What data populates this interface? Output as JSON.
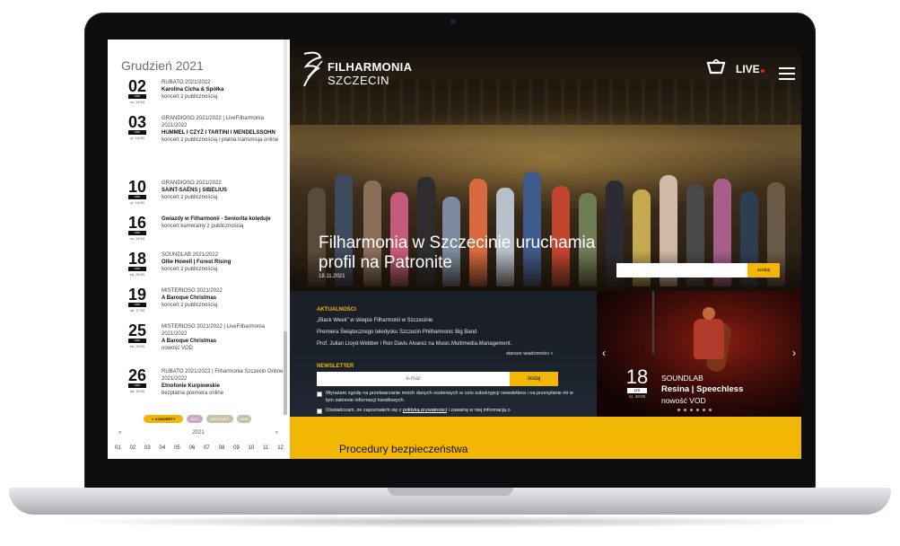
{
  "calendar": {
    "month": "Grudzień 2021",
    "events": [
      {
        "day": "02",
        "dow": "cz, 19:00",
        "cycle": "RUBATO 2021/2022",
        "title": "Karolina Cicha & Spółka",
        "desc": "koncert z publicznością"
      },
      {
        "day": "03",
        "dow": "pt, 19:00",
        "cycle": "GRANDIOSO 2021/2022 | LiveFilharmonia 2021/2022",
        "title": "HUMMEL I CZYŻ I TARTINI I MENDELSSOHN",
        "desc": "koncert z publicznością / płatna transmisja online"
      },
      {
        "day": "10",
        "dow": "pt, 19:00",
        "cycle": "GRANDIOSO 2021/2022",
        "title": "SAINT-SAËNS | SIBELIUS",
        "desc": "koncert z publicznością"
      },
      {
        "day": "16",
        "dow": "cz, 19:00",
        "cycle": "",
        "title": "Gwiazdy w Filharmonii - Seniorita kolęduje",
        "desc": "koncert kameralny z publicznością"
      },
      {
        "day": "18",
        "dow": "sb, 20:00",
        "cycle": "SOUNDLAB 2021/2022",
        "title": "Ollie Howell | Forest Rising",
        "desc": "koncert z publicznością"
      },
      {
        "day": "19",
        "dow": "nd, 17:00",
        "cycle": "MISTERIOSO 2021/2022",
        "title": "A Baroque Christmas",
        "desc": "koncert z publicznością"
      },
      {
        "day": "25",
        "dow": "sb, 19:00",
        "cycle": "MISTERIOSO 2021/2022 | LiveFilharmonia 2021/2022",
        "title": "A Baroque Christmas",
        "desc": "nowość VOD"
      },
      {
        "day": "26",
        "dow": "nd, 19:00",
        "cycle": "RUBATO 2021/2022 | Filharmonia Szczecin Online 2021/2022",
        "title": "Etnofonie Kurpiowskie",
        "desc": "bezpłatna premiera online"
      }
    ],
    "badge": "GRU",
    "filters": {
      "concerts": "KONCERTY",
      "other": "EDU",
      "exhibitions": "WYSTAWY",
      "misc": "INNE",
      "close_mark": "×"
    },
    "year": "2021",
    "prev": "«",
    "next": "»",
    "months": [
      "01",
      "02",
      "03",
      "04",
      "05",
      "06",
      "07",
      "08",
      "09",
      "10",
      "11",
      "12"
    ]
  },
  "header": {
    "logo_line1": "FILHARMONIA",
    "logo_line2": "SZCZECIN",
    "live_label": "LIVE"
  },
  "hero": {
    "title": "Filharmonia w Szczecinie uruchamia profil na Patronite",
    "date": "18.11.2021",
    "search_placeholder": "",
    "search_button": "szukaj"
  },
  "news": {
    "label": "AKTUALNOŚCI",
    "items": [
      "„Black Week” w sklepie Filharmonii w Szczecinie",
      "Premiera Świątecznego teledysku Szczecin Philharmonic Big Band",
      "Prof. Julian Lloyd-Webber i Ron Davis Alvarez na Music.Multimedia.Management."
    ],
    "older": "starsze wiadomości »"
  },
  "newsletter": {
    "label": "NEWSLETTER",
    "placeholder": "e-mail",
    "button": "dodaj",
    "consent1": "Wyrażam zgodę na przetwarzanie moich danych osobowych w celu subskrypcji newslettera i na przesyłanie mi w tym zakresie informacji handlowych.",
    "consent2_pre": "Oświadczam, że zapoznałem się z ",
    "consent2_link": "polityką prywatności",
    "consent2_post": " i zawartą w niej informacją o"
  },
  "slider": {
    "day": "18",
    "month": "LIS",
    "time": "cz, 20:00",
    "cycle": "SOUNDLAB",
    "title": "Resina | Speechless",
    "subtitle": "nowość VOD",
    "dot_count": 6,
    "arrow_left": "‹",
    "arrow_right": "›"
  },
  "band": {
    "title": "Procedury bezpieczeństwa"
  },
  "colors": {
    "accent": "#f2b705",
    "live_dot": "#e31e24"
  }
}
